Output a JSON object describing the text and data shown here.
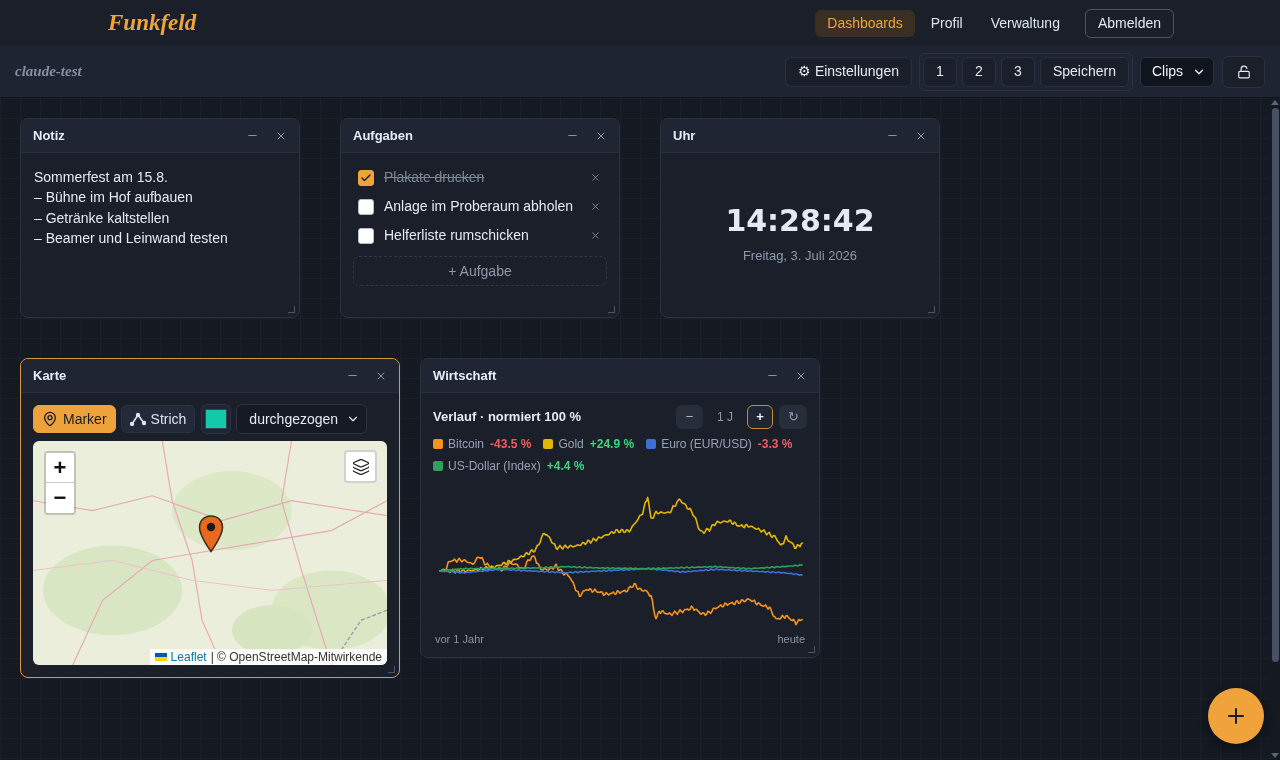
{
  "header": {
    "logo": "Funkfeld",
    "nav": [
      {
        "label": "Dashboards",
        "selected": true
      },
      {
        "label": "Profil",
        "selected": false
      },
      {
        "label": "Verwaltung",
        "selected": false
      }
    ],
    "logout_button": "Abmelden"
  },
  "toolbar": {
    "dashboard_name": "claude-test",
    "settings_button": "⚙ Einstellungen",
    "slots": [
      "1",
      "2",
      "3"
    ],
    "save_button": "Speichern",
    "view_select": {
      "value": "Clips"
    }
  },
  "widget_rows": [
    {
      "widgets": [
        {
          "kind": "note",
          "title": "Notiz",
          "focused": false,
          "text": "Sommerfest am 15.8.\n– Bühne im Hof aufbauen\n– Getränke kaltstellen\n– Beamer und Leinwand testen"
        },
        {
          "kind": "tasks",
          "title": "Aufgaben",
          "focused": false,
          "tasks": [
            {
              "text": "Plakate drucken",
              "checked": true
            },
            {
              "text": "Anlage im Proberaum abholen",
              "checked": false
            },
            {
              "text": "Helferliste rumschicken",
              "checked": false
            }
          ],
          "add_button": "+ Aufgabe"
        },
        {
          "kind": "clock",
          "title": "Uhr",
          "focused": false,
          "time": "14:28:42",
          "date": "Freitag, 3. Juli 2026"
        }
      ]
    },
    {
      "widgets": [
        {
          "kind": "map",
          "title": "Karte",
          "focused": true,
          "tools": [
            {
              "kind": "marker",
              "label": "Marker",
              "selected": true
            },
            {
              "kind": "line",
              "label": "Strich",
              "selected": false
            }
          ],
          "color_picker": {
            "color": "#13c9a9"
          },
          "line_style": "durchgezogen",
          "map": {
            "zoom_in": "+",
            "zoom_out": "−",
            "attribution_link": "Leaflet",
            "attribution_text": "| © OpenStreetMap-Mitwirkende"
          }
        },
        {
          "kind": "economy",
          "title": "Wirtschaft",
          "focused": false,
          "subtitle": "Verlauf · normiert 100 %",
          "range": {
            "decrease": "−",
            "value": "1 J",
            "increase": "+",
            "refresh": "↻"
          },
          "series": [
            {
              "name": "Bitcoin",
              "change": "-43.5 %",
              "negative": true,
              "color": "#f7931a"
            },
            {
              "name": "Gold",
              "change": "+24.9 %",
              "negative": false,
              "color": "#e3b505"
            },
            {
              "name": "Euro (EUR/USD)",
              "change": "-3.3 %",
              "negative": true,
              "color": "#3d6fd9"
            },
            {
              "name": "US-Dollar (Index)",
              "change": "+4.4 %",
              "negative": false,
              "color": "#2e9f5c"
            }
          ],
          "x_start": "vor 1 Jahr",
          "x_end": "heute"
        }
      ]
    }
  ]
}
